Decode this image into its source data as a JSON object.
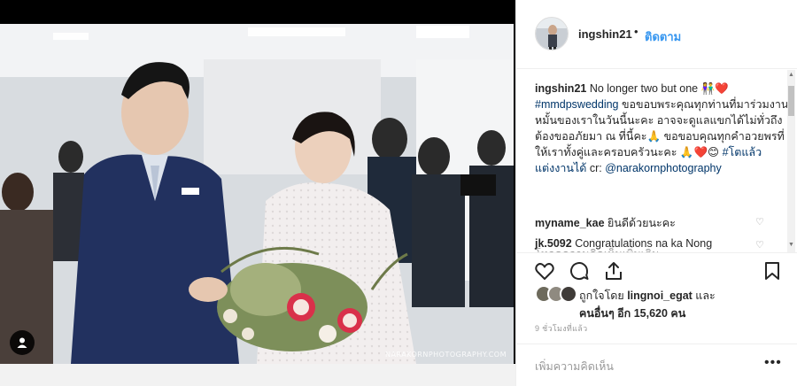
{
  "post": {
    "photo_watermark": "NARAKORNPHOTOGRAPHY.COM"
  },
  "header": {
    "username": "ingshin21",
    "separator": "•",
    "follow_label": "ติดตาม"
  },
  "caption": {
    "username": "ingshin21",
    "text_1": "No longer two but one ",
    "emoji_1": "👫❤️",
    "hashtag_1": "#mmdpswedding",
    "text_2": " ขอขอบพระคุณทุกท่านที่มาร่วมงานหมั้นของเราในวันนี้นะคะ อาจจะดูแลแขกได้ไม่ทั่วถึงต้องขออภัยมา ณ ที่นี้คะ",
    "emoji_2": "🙏",
    "text_3": " ขอขอบคุณทุกคำอวยพรที่ให้เราทั้งคู่และครอบครัวนะคะ ",
    "emoji_3": "🙏❤️😊",
    "hashtag_2": "#โตแล้วแต่งงานได้",
    "text_4": " cr: ",
    "mention": "@narakornphotography"
  },
  "load_more_label": "โหลดความคิดเห็นเพิ่มเติม",
  "comments": [
    {
      "username": "myname_kae",
      "text": "ยินดีด้วยนะคะ"
    },
    {
      "username": "jk.5092",
      "text": "Congratulations na ka Nong"
    }
  ],
  "likes": {
    "prefix": "ถูกใจโดย ",
    "user": "lingnoi_egat",
    "middle": " และ",
    "others_prefix": "คนอื่นๆ อีก ",
    "count": "15,620",
    "suffix": " คน"
  },
  "timestamp": "9 ชั่วโมงที่แล้ว",
  "add_comment_placeholder": "เพิ่มความคิดเห็น",
  "more_label": "•••",
  "colors": {
    "link_blue": "#3897f0",
    "hashtag": "#003569",
    "muted": "#999999",
    "heart_red": "#ed4956"
  }
}
